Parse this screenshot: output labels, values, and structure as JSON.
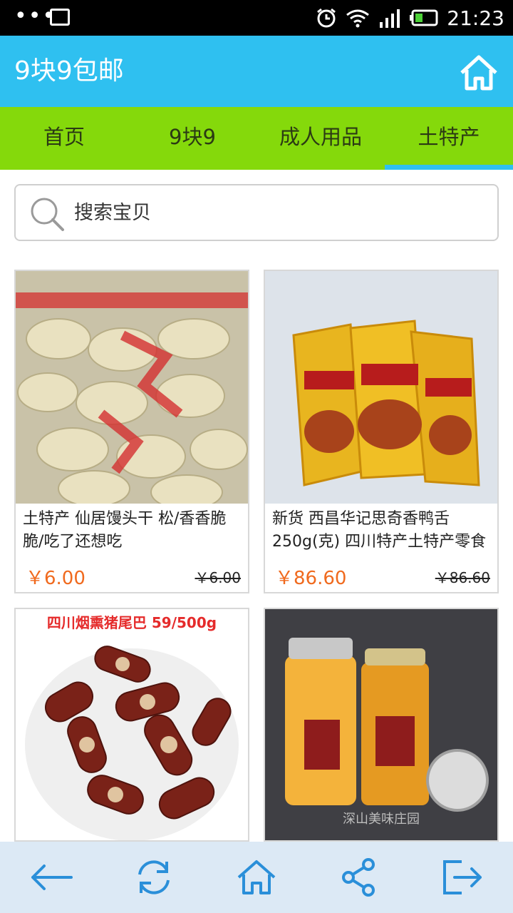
{
  "status_bar": {
    "time": "21:23",
    "left_icons": [
      "more-dots-icon",
      "image-icon"
    ],
    "right_icons": [
      "alarm-icon",
      "wifi-icon",
      "signal-icon",
      "battery-icon"
    ]
  },
  "header": {
    "title": "9块9包邮",
    "home_icon": "home-icon"
  },
  "tabs": [
    {
      "label": "首页",
      "active": false
    },
    {
      "label": "9块9",
      "active": false
    },
    {
      "label": "成人用品",
      "active": false
    },
    {
      "label": "土特产",
      "active": true
    }
  ],
  "search": {
    "placeholder": "搜索宝贝",
    "icon": "search-icon"
  },
  "products": [
    {
      "name": "土特产 仙居馒头干 松/香香脆脆/吃了还想吃",
      "price": "￥6.00",
      "original_price": "￥6.00"
    },
    {
      "name": "新货 西昌华记思奇香鸭舌250g(克) 四川特产土特产零食",
      "price": "￥86.60",
      "original_price": "￥86.60"
    },
    {
      "name": "",
      "price": "",
      "original_price": "",
      "image_caption": "四川烟熏猪尾巴 59/500g"
    },
    {
      "name": "",
      "price": "",
      "original_price": "",
      "image_caption": "深山美味庄园"
    }
  ],
  "bottom_nav": [
    "back-arrow-icon",
    "refresh-icon",
    "home-icon",
    "share-icon",
    "exit-icon"
  ],
  "colors": {
    "header": "#2fc0f0",
    "tabs": "#85d90b",
    "price": "#f06a1e",
    "bottom_bar": "#dce9f5"
  }
}
